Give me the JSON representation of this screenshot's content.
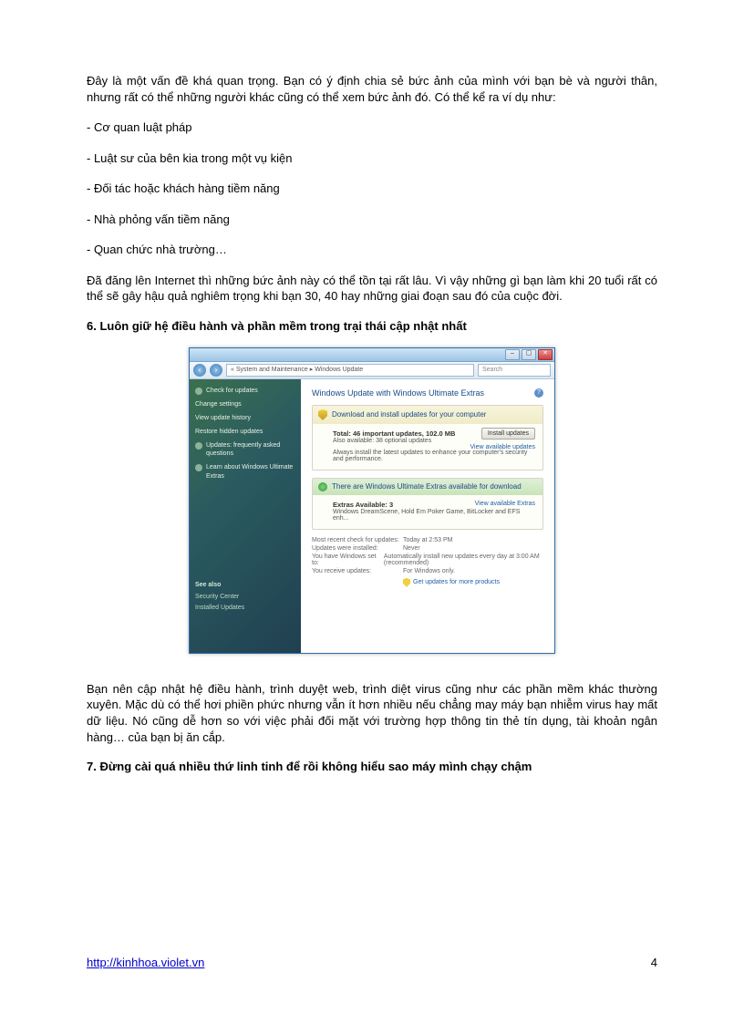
{
  "intro": "Đây là một vấn đề khá quan trọng. Bạn có ý định chia sẻ bức ảnh của mình với bạn bè và người thân, nhưng rất có thể những người khác cũng có thể xem bức ảnh đó. Có thể kể ra ví dụ như:",
  "bullets": [
    "- Cơ quan luật pháp",
    "- Luật sư của bên kia trong một vụ kiện",
    "- Đối tác hoặc khách hàng tiềm năng",
    "- Nhà phỏng vấn tiềm năng",
    "- Quan chức nhà trường…"
  ],
  "warning": "Đã đăng lên Internet thì những bức ảnh này có thể tồn tại rất lâu. Vì vậy những gì bạn làm khi 20 tuổi rất có thể sẽ gây hậu quả nghiêm trọng khi bạn 30, 40 hay những giai đoạn sau đó của cuộc đời.",
  "heading6": "6. Luôn giữ hệ điều hành và phần mềm trong trại thái cập nhật nhất",
  "window": {
    "breadcrumb": "« System and Maintenance ▸ Windows Update",
    "search": "Search",
    "sidebar": [
      "Check for updates",
      "Change settings",
      "View update history",
      "Restore hidden updates",
      "Updates: frequently asked questions",
      "Learn about Windows Ultimate Extras"
    ],
    "seealso_title": "See also",
    "seealso": [
      "Security Center",
      "Installed Updates"
    ],
    "main_title": "Windows Update with Windows Ultimate Extras",
    "box1_title": "Download and install updates for your computer",
    "box1_bold": "Total: 46 important updates, 102.0 MB",
    "box1_sub": "Also available: 38 optional updates",
    "box1_note": "Always install the latest updates to enhance your computer's security and performance.",
    "install_btn": "Install updates",
    "view_avail": "View available updates",
    "box2_title": "There are Windows Ultimate Extras available for download",
    "box2_bold": "Extras Available: 3",
    "box2_sub": "Windows DreamScene, Hold Em Poker Game, BitLocker and EFS enh...",
    "view_extras": "View available Extras",
    "status": [
      {
        "label": "Most recent check for updates:",
        "value": "Today at 2:53 PM"
      },
      {
        "label": "Updates were installed:",
        "value": "Never"
      },
      {
        "label": "You have Windows set to:",
        "value": "Automatically install new updates every day at 3:00 AM (recommended)"
      },
      {
        "label": "You receive updates:",
        "value": "For Windows only."
      }
    ],
    "get_updates": "Get updates for more products"
  },
  "para_after": "Bạn nên cập nhật hệ điều hành, trình duyệt web, trình diệt virus cũng như các phần mềm khác thường xuyên. Mặc dù có thể hơi phiền phức nhưng vẫn ít hơn nhiều nếu chẳng may máy bạn nhiễm virus hay mất dữ liệu. Nó cũng dễ hơn so với việc phải đối mặt với trường hợp thông tin thẻ tín dụng, tài khoản ngân hàng… của bạn bị ăn cắp.",
  "heading7": "7. Đừng cài quá nhiều thứ linh tinh để rồi không hiểu sao máy mình chạy chậm",
  "footer_link": "http://kinhhoa.violet.vn",
  "page_num": "4"
}
